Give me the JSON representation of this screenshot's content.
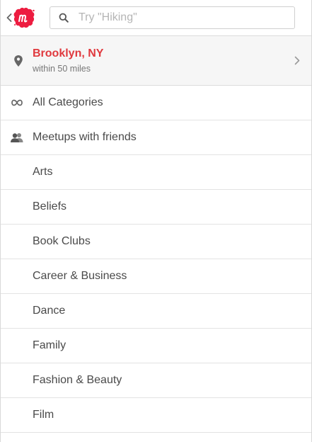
{
  "header": {
    "back_icon": "chevron-left-icon",
    "logo_icon": "meetup-logo-icon",
    "brand_color": "#ed1c40",
    "search": {
      "placeholder": "Try \"Hiking\"",
      "value": "",
      "icon": "search-icon"
    }
  },
  "location": {
    "icon": "map-pin-icon",
    "city": "Brooklyn, NY",
    "radius": "within 50 miles",
    "city_color": "#e0393e",
    "chevron_icon": "chevron-right-icon"
  },
  "categories": {
    "items": [
      {
        "label": "All Categories",
        "icon": "infinity-icon"
      },
      {
        "label": "Meetups with friends",
        "icon": "friends-icon"
      },
      {
        "label": "Arts"
      },
      {
        "label": "Beliefs"
      },
      {
        "label": "Book Clubs"
      },
      {
        "label": "Career & Business"
      },
      {
        "label": "Dance"
      },
      {
        "label": "Family"
      },
      {
        "label": "Fashion & Beauty"
      },
      {
        "label": "Film"
      }
    ]
  }
}
